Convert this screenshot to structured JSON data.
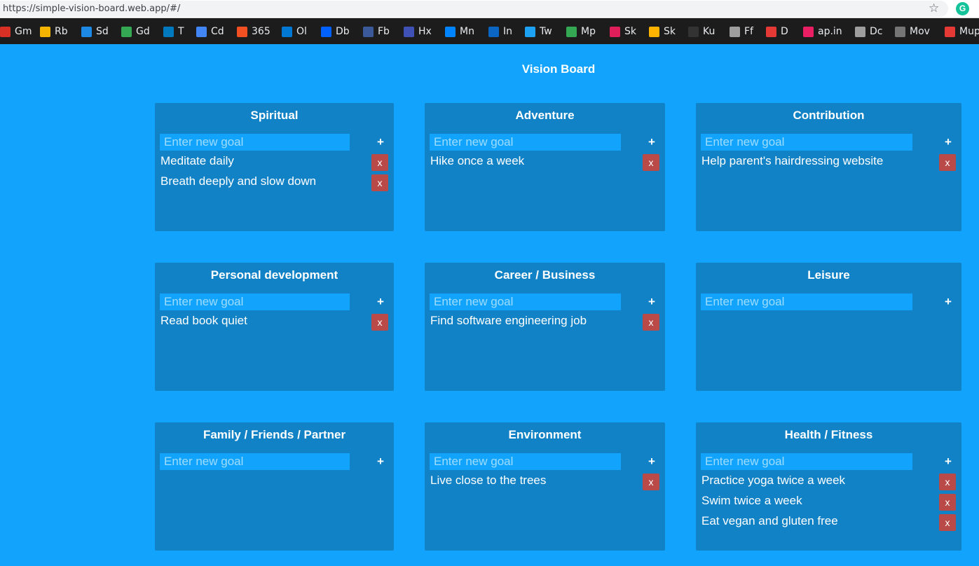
{
  "browser": {
    "url": "https://simple-vision-board.web.app/#/",
    "extension_letter": "G",
    "bookmarks": [
      {
        "label": "Gm",
        "icon": "gmail-icon",
        "color": "#d93025"
      },
      {
        "label": "Rb",
        "icon": "rb-icon",
        "color": "#f4b400"
      },
      {
        "label": "Sd",
        "icon": "onedrive-icon",
        "color": "#1e88e5"
      },
      {
        "label": "Gd",
        "icon": "google-drive-icon",
        "color": "#34a853"
      },
      {
        "label": "T",
        "icon": "trello-icon",
        "color": "#0079bf"
      },
      {
        "label": "Cd",
        "icon": "calendar-icon",
        "color": "#4285f4"
      },
      {
        "label": "365",
        "icon": "microsoft-icon",
        "color": "#f25022"
      },
      {
        "label": "Ol",
        "icon": "outlook-icon",
        "color": "#0078d4"
      },
      {
        "label": "Db",
        "icon": "dropbox-icon",
        "color": "#0061ff"
      },
      {
        "label": "Fb",
        "icon": "facebook-icon",
        "color": "#3b5998"
      },
      {
        "label": "Hx",
        "icon": "hx-icon",
        "color": "#3f51b5"
      },
      {
        "label": "Mn",
        "icon": "messenger-icon",
        "color": "#0084ff"
      },
      {
        "label": "In",
        "icon": "linkedin-icon",
        "color": "#0a66c2"
      },
      {
        "label": "Tw",
        "icon": "twitter-icon",
        "color": "#1da1f2"
      },
      {
        "label": "Mp",
        "icon": "maps-icon",
        "color": "#34a853"
      },
      {
        "label": "Sk",
        "icon": "slack-icon",
        "color": "#e01e5a"
      },
      {
        "label": "Sk",
        "icon": "sketch-icon",
        "color": "#fdb300"
      },
      {
        "label": "Ku",
        "icon": "github-icon",
        "color": "#333333"
      },
      {
        "label": "Ff",
        "icon": "folder-icon",
        "color": "#9e9e9e"
      },
      {
        "label": "D",
        "icon": "d-icon",
        "color": "#e53935"
      },
      {
        "label": "ap.in",
        "icon": "app-icon",
        "color": "#e91e63"
      },
      {
        "label": "Dc",
        "icon": "folder-icon",
        "color": "#9e9e9e"
      },
      {
        "label": "Mov",
        "icon": "globe-icon",
        "color": "#757575"
      },
      {
        "label": "Mup",
        "icon": "m-icon",
        "color": "#e53935"
      }
    ]
  },
  "board": {
    "title": "Vision Board",
    "placeholder": "Enter new goal",
    "add_label": "+",
    "delete_label": "x",
    "categories": [
      {
        "title": "Spiritual",
        "goals": [
          "Meditate daily",
          "Breath deeply and slow down"
        ]
      },
      {
        "title": "Adventure",
        "goals": [
          "Hike once a week"
        ]
      },
      {
        "title": "Contribution",
        "goals": [
          "Help parent's hairdressing website"
        ]
      },
      {
        "title": "Personal development",
        "goals": [
          "Read book quiet"
        ]
      },
      {
        "title": "Career / Business",
        "goals": [
          "Find software engineering job"
        ]
      },
      {
        "title": "Leisure",
        "goals": []
      },
      {
        "title": "Family / Friends / Partner",
        "goals": []
      },
      {
        "title": "Environment",
        "goals": [
          "Live close to the trees"
        ]
      },
      {
        "title": "Health / Fitness",
        "goals": [
          "Practice yoga twice a week",
          "Swim twice a week",
          "Eat vegan and gluten free"
        ]
      }
    ]
  }
}
